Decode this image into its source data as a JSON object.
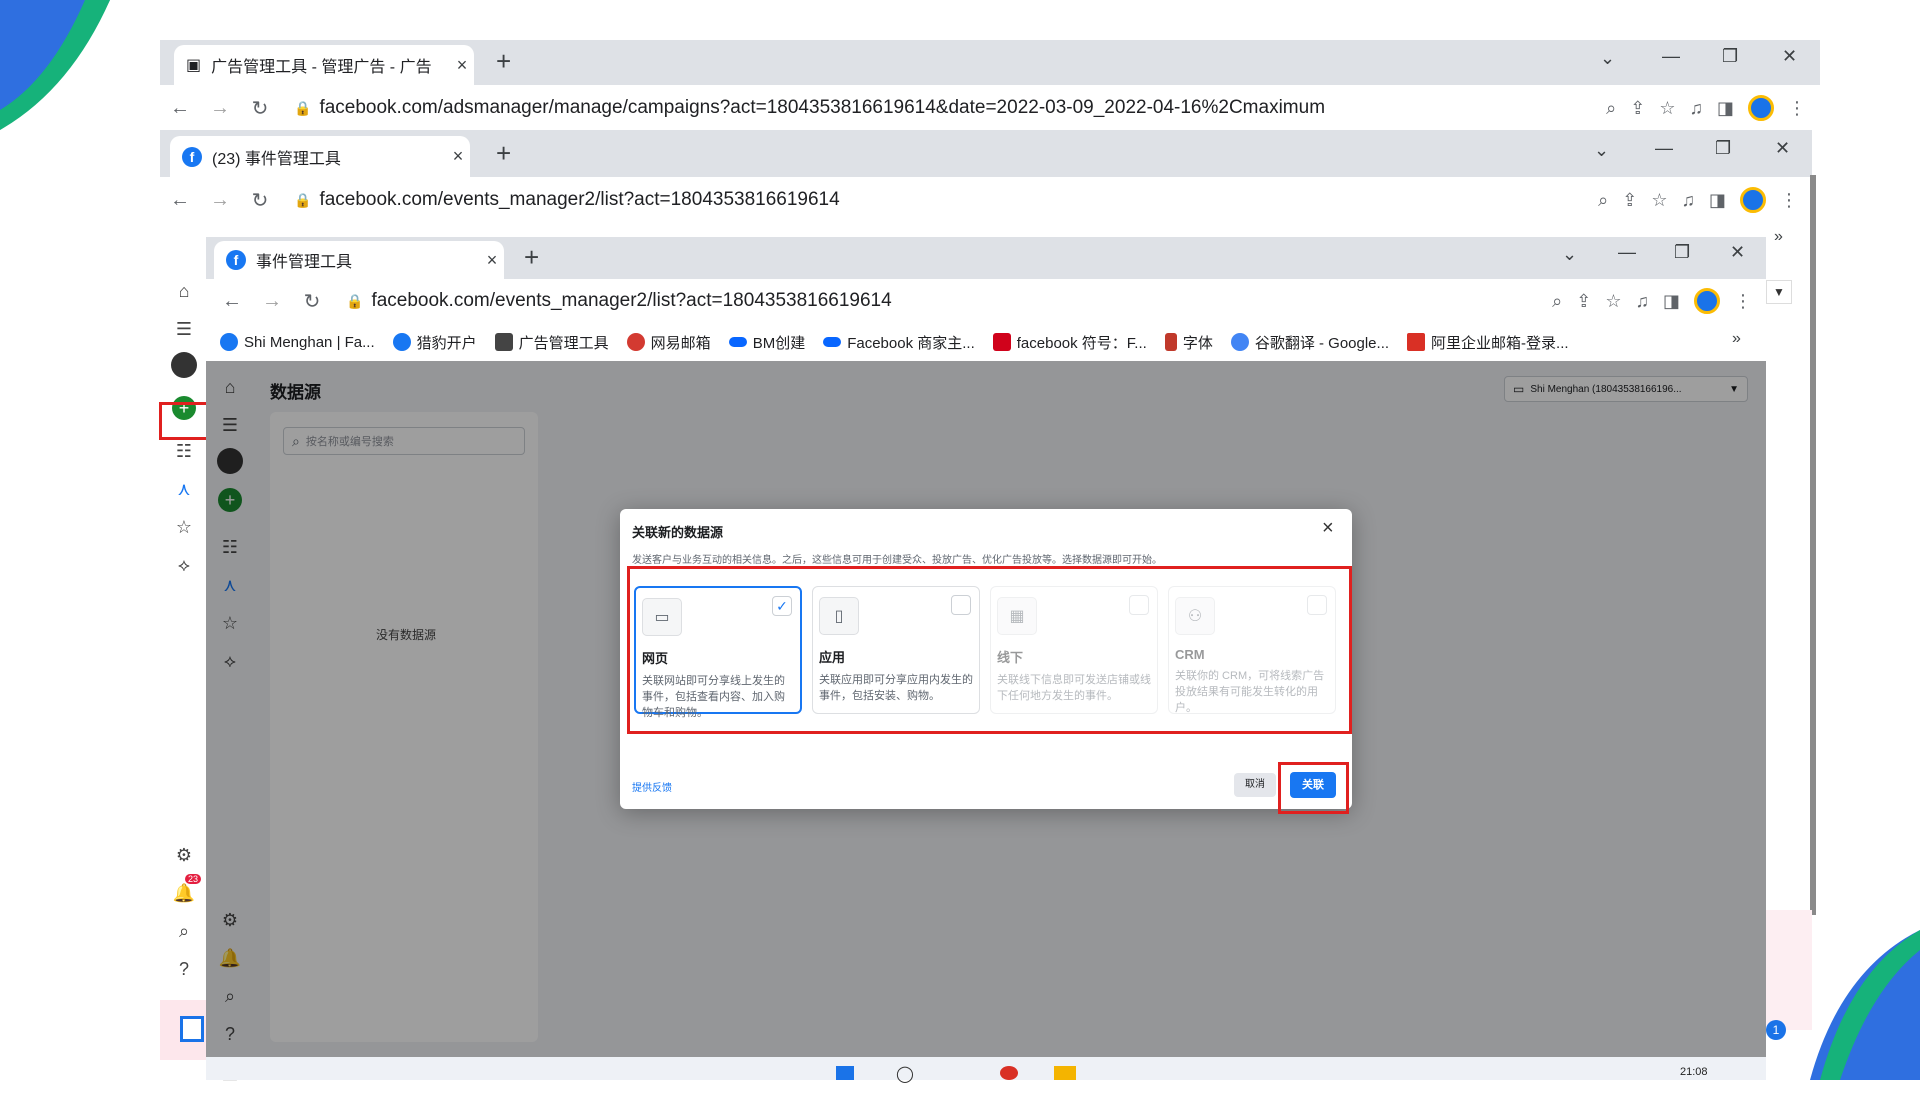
{
  "window1": {
    "tab_title": "广告管理工具 - 管理广告 - 广告",
    "url": "facebook.com/adsmanager/manage/campaigns?act=1804353816619614&date=2022-03-09_2022-04-16%2Cmaximum"
  },
  "window2": {
    "tab_title": "(23) 事件管理工具",
    "url": "facebook.com/events_manager2/list?act=1804353816619614"
  },
  "window3": {
    "tab_title": "事件管理工具",
    "url": "facebook.com/events_manager2/list?act=1804353816619614",
    "bookmarks": [
      {
        "label": "Shi Menghan | Fa...",
        "icon": "facebook-icon",
        "color": "#1877f2"
      },
      {
        "label": "猎豹开户",
        "icon": "facebook-icon",
        "color": "#1877f2"
      },
      {
        "label": "广告管理工具",
        "icon": "ads-manager-icon",
        "color": "#444444"
      },
      {
        "label": "网易邮箱",
        "icon": "netease-mail-icon",
        "color": "#d33a31"
      },
      {
        "label": "BM创建",
        "icon": "meta-icon",
        "color": "#0866ff"
      },
      {
        "label": "Facebook 商家主...",
        "icon": "meta-icon",
        "color": "#0866ff"
      },
      {
        "label": "facebook 符号：F...",
        "icon": "font-icon",
        "color": "#d0021b"
      },
      {
        "label": "字体",
        "icon": "bookmark-icon",
        "color": "#c0392b"
      },
      {
        "label": "谷歌翻译 - Google...",
        "icon": "google-icon",
        "color": "#4285f4"
      },
      {
        "label": "阿里企业邮箱-登录...",
        "icon": "gmail-icon",
        "color": "#d93025"
      }
    ],
    "more_bookmarks": "»"
  },
  "page": {
    "title": "数据源",
    "search_placeholder": "按名称或编号搜索",
    "empty_text": "没有数据源",
    "account_selector": "Shi Menghan (18043538166196..."
  },
  "modal": {
    "title": "关联新的数据源",
    "close": "×",
    "description": "发送客户与业务互动的相关信息。之后，这些信息可用于创建受众、投放广告、优化广告投放等。选择数据源即可开始。",
    "options": [
      {
        "title": "网页",
        "desc": "关联网站即可分享线上发生的事件，包括查看内容、加入购物车和购物。",
        "icon": "monitor-icon",
        "selected": true,
        "disabled": false
      },
      {
        "title": "应用",
        "desc": "关联应用即可分享应用内发生的事件，包括安装、购物。",
        "icon": "phone-icon",
        "selected": false,
        "disabled": false
      },
      {
        "title": "线下",
        "desc": "关联线下信息即可发送店铺或线下任何地方发生的事件。",
        "icon": "store-icon",
        "selected": false,
        "disabled": true
      },
      {
        "title": "CRM",
        "desc": "关联你的 CRM，可将线索广告投放结果有可能发生转化的用户。",
        "icon": "crm-icon",
        "selected": false,
        "disabled": true
      }
    ],
    "feedback_link": "提供反馈",
    "cancel_label": "取消",
    "connect_label": "关联"
  },
  "notification_badge": "23",
  "taskbar_badge": "1",
  "clock": "21:08",
  "accent_color": "#1877f2",
  "highlight_color": "#e0201f"
}
